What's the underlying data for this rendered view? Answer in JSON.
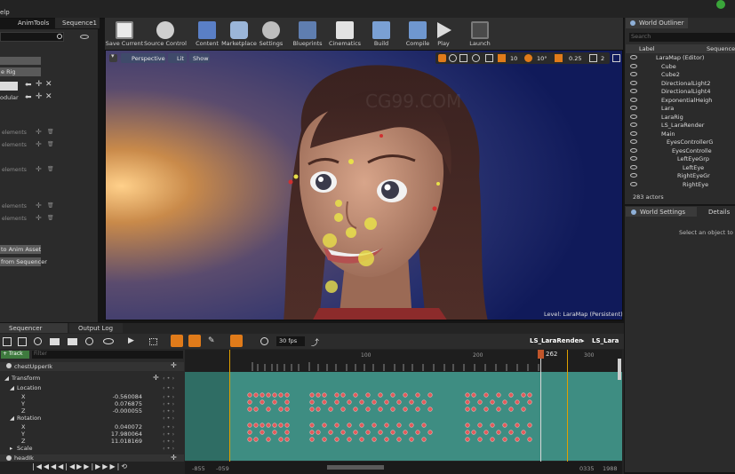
{
  "menu": {
    "help_fragment": "elp"
  },
  "tabs": {
    "anim_tools": "AnimTools",
    "sequence": "Sequence1"
  },
  "toolbar": {
    "save": "Save Current",
    "source_control": "Source Control",
    "content": "Content",
    "marketplace": "Marketplace",
    "settings": "Settings",
    "blueprints": "Blueprints",
    "cinematics": "Cinematics",
    "build": "Build",
    "compile": "Compile",
    "play": "Play",
    "launch": "Launch"
  },
  "left_panel": {
    "rig_fragment": "e Rig",
    "dropdown_fragment": "odular",
    "elements_label": "elements",
    "to_anim_asset": "to Anim Asset",
    "from_sequencer": "from Sequencer"
  },
  "viewport": {
    "perspective": "Perspective",
    "lit": "Lit",
    "show": "Show",
    "grid_snap": "10",
    "rot_snap": "10°",
    "scale_snap": "0.25",
    "camera_speed": "2",
    "level_label": "Level:  LaraMap (Persistent)",
    "watermark": "CG99.COM"
  },
  "outliner": {
    "title": "World Outliner",
    "search_placeholder": "Search",
    "col_label": "Label",
    "col_sequence": "Sequence",
    "items": [
      "LaraMap (Editor)",
      "Cube",
      "Cube2",
      "DirectionalLight2",
      "DirectionalLight4",
      "ExponentialHeigh",
      "Lara",
      "LaraRig",
      "LS_LaraRender",
      "Main",
      "EyesControllerG",
      "EyesControlle",
      "LeftEyeGrp",
      "LeftEye",
      "RightEyeGr",
      "RightEye"
    ],
    "actor_count": "283 actors"
  },
  "details": {
    "world_settings_tab": "World Settings",
    "details_tab": "Details",
    "empty_message": "Select an object to view"
  },
  "sequencer": {
    "tab": "Sequencer",
    "output_log_tab": "Output Log",
    "fps": "30 fps",
    "breadcrumb_root": "LS_LaraRender",
    "breadcrumb_leaf": "LS_Lara",
    "track_button": "+ Track",
    "filter_placeholder": "Filter",
    "rows": {
      "bone": "chestUpperIk",
      "transform": "Transform",
      "location": "Location",
      "rotation": "Rotation",
      "scale": "Scale",
      "next_bone": "headIk"
    },
    "values": {
      "loc_x": "-0.560084",
      "loc_y": "0.076875",
      "loc_z": "-0.000055",
      "rot_x": "0.040072",
      "rot_y": "17.980064",
      "rot_z": "11.018169"
    },
    "axes": {
      "x": "X",
      "y": "Y",
      "z": "Z"
    },
    "ruler": [
      "100",
      "200",
      "300"
    ],
    "playhead": "262",
    "range_start": "-855",
    "range_view_start": "-059",
    "range_view_end": "0335",
    "range_end": "1988"
  }
}
